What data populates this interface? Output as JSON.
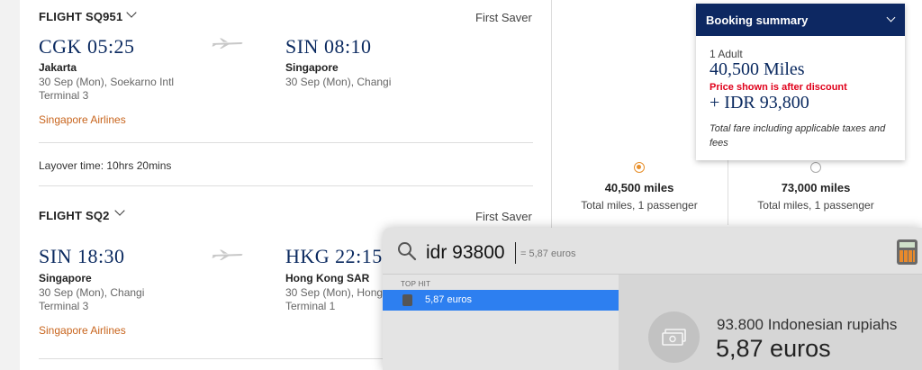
{
  "flights": [
    {
      "title": "FLIGHT SQ951",
      "fare_class": "First Saver",
      "origin": {
        "code_time": "CGK 05:25",
        "city": "Jakarta",
        "date_place": "30 Sep (Mon), Soekarno Intl",
        "terminal": "Terminal 3"
      },
      "destination": {
        "code_time": "SIN 08:10",
        "city": "Singapore",
        "date_place": "30 Sep (Mon), Changi",
        "terminal": ""
      },
      "airline": "Singapore Airlines"
    },
    {
      "title": "FLIGHT SQ2",
      "fare_class": "First Saver",
      "origin": {
        "code_time": "SIN 18:30",
        "city": "Singapore",
        "date_place": "30 Sep (Mon), Changi",
        "terminal": "Terminal 3"
      },
      "destination": {
        "code_time": "HKG 22:15",
        "city": "Hong Kong SAR",
        "date_place": "30 Sep (Mon), Hong",
        "terminal": "Terminal 1"
      },
      "airline": "Singapore Airlines"
    }
  ],
  "layover": "Layover time: 10hrs 20mins",
  "fare_options": [
    {
      "miles": "40,500 miles",
      "sub": "Total miles, 1 passenger",
      "selected": true
    },
    {
      "miles": "73,000 miles",
      "sub": "Total miles, 1 passenger",
      "selected": false
    }
  ],
  "summary": {
    "title": "Booking summary",
    "passengers": "1 Adult",
    "miles": "40,500 Miles",
    "discount_note": "Price shown is after discount",
    "cash": "+ IDR 93,800",
    "fare_note": "Total fare including applicable taxes and fees"
  },
  "spotlight": {
    "query": "idr 93800",
    "inline_result": "= 5,87 euros",
    "section_label": "TOP HIT",
    "top_hit": "5,87 euros",
    "conversion_from": "93.800 Indonesian rupiahs",
    "conversion_to": "5,87 euros"
  },
  "colors": {
    "navy": "#0d2862",
    "accent_orange": "#e8902c",
    "airline_orange": "#c8641c",
    "discount_red": "#e0001a",
    "spotlight_selection": "#2d7ff0"
  }
}
